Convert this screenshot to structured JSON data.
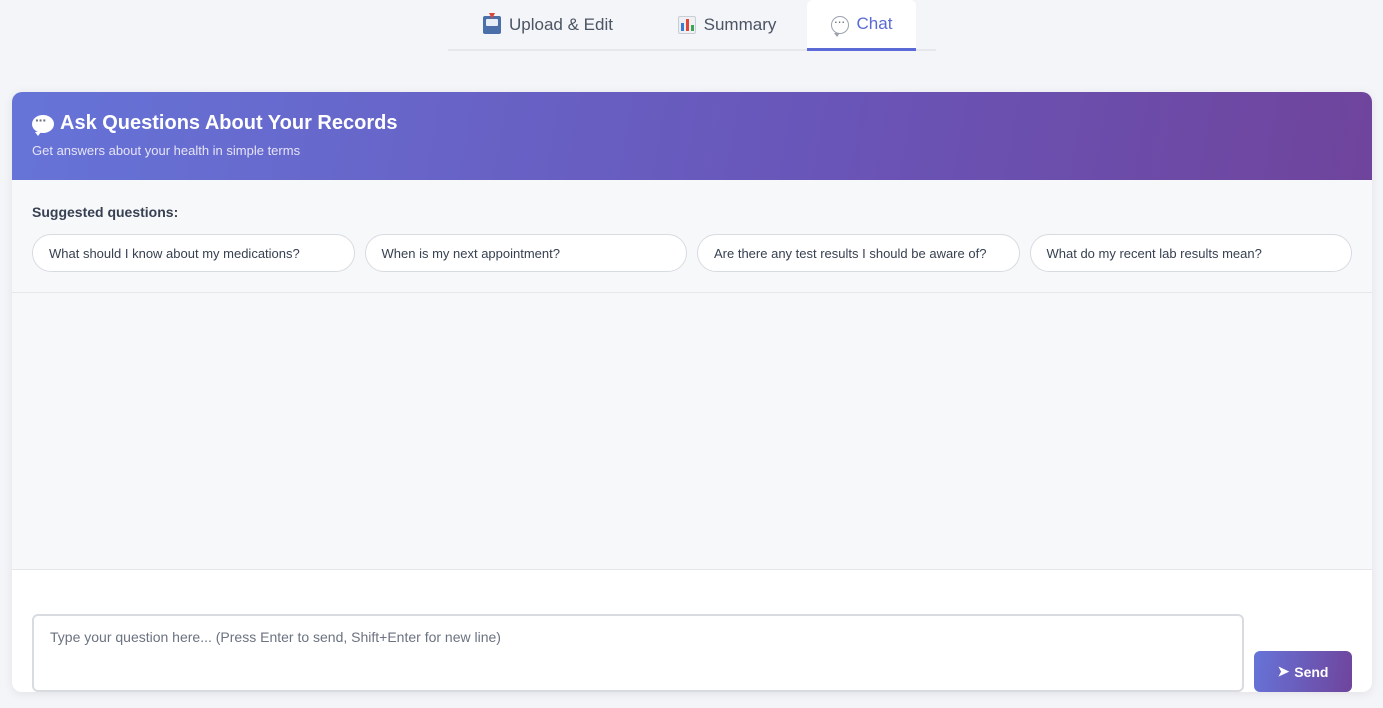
{
  "tabs": [
    {
      "label": "Upload & Edit",
      "icon": "inbox-tray-icon"
    },
    {
      "label": "Summary",
      "icon": "bar-chart-icon"
    },
    {
      "label": "Chat",
      "icon": "speech-bubble-icon",
      "active": true
    }
  ],
  "chat": {
    "title": "Ask Questions About Your Records",
    "subtitle": "Get answers about your health in simple terms",
    "suggested_label": "Suggested questions:",
    "suggestions": [
      "What should I know about my medications?",
      "When is my next appointment?",
      "Are there any test results I should be aware of?",
      "What do my recent lab results mean?"
    ],
    "input_placeholder": "Type your question here... (Press Enter to send, Shift+Enter for new line)",
    "send_label": "Send",
    "send_icon": "➤"
  },
  "colors": {
    "accent": "#5b6ad6",
    "header_gradient_start": "#6674d8",
    "header_gradient_end": "#6f449c"
  }
}
